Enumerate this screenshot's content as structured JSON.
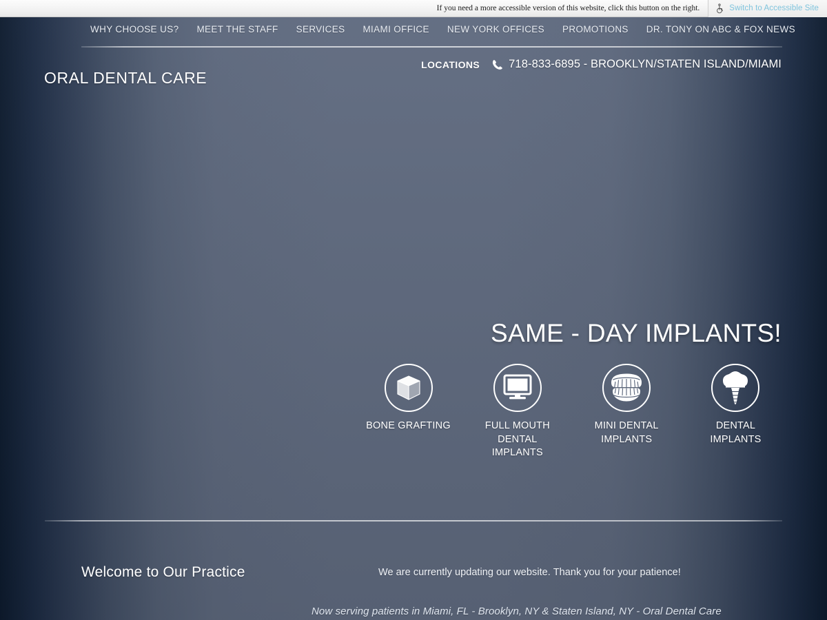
{
  "accessibility_bar": {
    "note": "If you need a more accessible version of this website, click this button on the right.",
    "button_label": "Switch to Accessible Site",
    "button_icon": "wheelchair-icon",
    "link_color": "#7fc4dd"
  },
  "nav": {
    "items": [
      {
        "label": "WHY CHOOSE US?"
      },
      {
        "label": "MEET THE STAFF"
      },
      {
        "label": "SERVICES"
      },
      {
        "label": "MIAMI OFFICE"
      },
      {
        "label": "NEW YORK OFFICES"
      },
      {
        "label": "PROMOTIONS"
      },
      {
        "label": "DR. TONY ON ABC & FOX NEWS"
      }
    ]
  },
  "brand": {
    "name": "ORAL DENTAL CARE"
  },
  "contact": {
    "locations_label": "LOCATIONS",
    "phone_icon": "phone-icon",
    "phone_text": "718-833-6895 - BROOKLYN/STATEN ISLAND/MIAMI"
  },
  "hero": {
    "title": "SAME - DAY IMPLANTS!"
  },
  "services": [
    {
      "label": "BONE GRAFTING",
      "icon": "cube-icon"
    },
    {
      "label": "FULL MOUTH\nDENTAL\nIMPLANTS",
      "icon": "monitor-icon"
    },
    {
      "label": "MINI DENTAL\nIMPLANTS",
      "icon": "teeth-icon"
    },
    {
      "label": "DENTAL\nIMPLANTS",
      "icon": "dental-implant-icon"
    }
  ],
  "welcome": {
    "heading": "Welcome to Our Practice",
    "body": "We are currently updating our website. Thank you for your patience!",
    "serving": "Now serving patients in Miami, FL - Brooklyn, NY & Staten Island, NY - Oral Dental Care"
  },
  "theme": {
    "background_center": "#606b80",
    "background_edge": "#0d1b2e",
    "text_primary": "#ffffff"
  }
}
